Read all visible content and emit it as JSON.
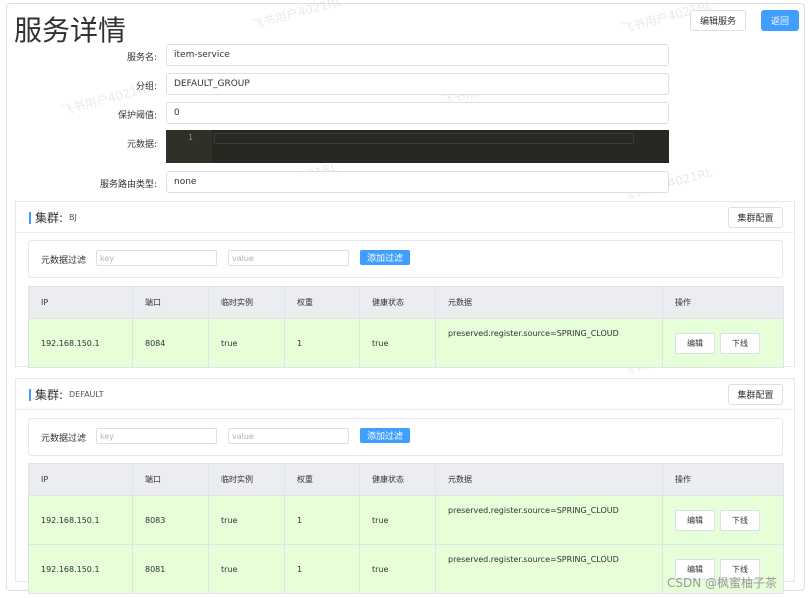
{
  "page": {
    "title": "服务详情",
    "edit_button": "编辑服务",
    "back_button": "返回"
  },
  "form": {
    "service_name_label": "服务名:",
    "service_name_value": "item-service",
    "group_label": "分组:",
    "group_value": "DEFAULT_GROUP",
    "threshold_label": "保护阈值:",
    "threshold_value": "0",
    "metadata_label": "元数据:",
    "metadata_line": "1",
    "selector_label": "服务路由类型:",
    "selector_value": "none"
  },
  "table_headers": [
    "IP",
    "端口",
    "临时实例",
    "权重",
    "健康状态",
    "元数据",
    "操作"
  ],
  "clusters": [
    {
      "title": "集群:",
      "name": "BJ",
      "config_button": "集群配置",
      "filter_label": "元数据过滤",
      "key_placeholder": "key",
      "value_placeholder": "value",
      "filter_button": "添加过滤",
      "rows": [
        {
          "ip": "192.168.150.1",
          "port": "8084",
          "ephemeral": "true",
          "weight": "1",
          "healthy": "true",
          "metadata": "preserved.register.source=SPRING_CLOUD",
          "edit": "编辑",
          "offline": "下线"
        }
      ]
    },
    {
      "title": "集群:",
      "name": "DEFAULT",
      "config_button": "集群配置",
      "filter_label": "元数据过滤",
      "key_placeholder": "key",
      "value_placeholder": "value",
      "filter_button": "添加过滤",
      "rows": [
        {
          "ip": "192.168.150.1",
          "port": "8083",
          "ephemeral": "true",
          "weight": "1",
          "healthy": "true",
          "metadata": "preserved.register.source=SPRING_CLOUD",
          "edit": "编辑",
          "offline": "下线"
        },
        {
          "ip": "192.168.150.1",
          "port": "8081",
          "ephemeral": "true",
          "weight": "1",
          "healthy": "true",
          "metadata": "preserved.register.source=SPRING_CLOUD",
          "edit": "编辑",
          "offline": "下线"
        }
      ]
    }
  ],
  "watermark": "飞书用户4021RL",
  "credit": "CSDN @枫蜜柚子茶",
  "colors": {
    "primary": "#409eff",
    "row_bg": "#e6ffd9",
    "header_bg": "#ebedf0"
  }
}
